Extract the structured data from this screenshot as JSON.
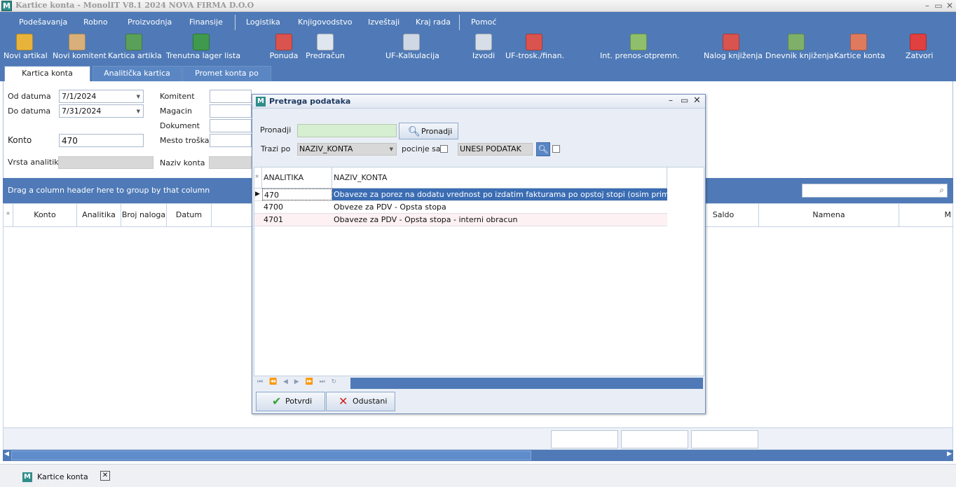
{
  "window": {
    "title": "Kartice konta - MonolIT V8.1 2024 NOVA FIRMA D.O.O",
    "min": "–",
    "max": "▭",
    "close": "✕"
  },
  "menu": [
    "Podešavanja",
    "Robno",
    "Proizvodnja",
    "Finansije",
    "Logistika",
    "Knjigovodstvo",
    "Izveštaji",
    "Kraj rada",
    "Pomoć"
  ],
  "toolbar": [
    {
      "label": "Novi artikal",
      "icon": "basket-icon",
      "color": "#e8b33a"
    },
    {
      "label": "Novi komitent",
      "icon": "person-add-icon",
      "color": "#d9b07a"
    },
    {
      "label": "Kartica artikla",
      "icon": "calendar-icon",
      "color": "#5aa05a"
    },
    {
      "label": "Trenutna lager lista",
      "icon": "chart-doc-icon",
      "color": "#3f9a4d"
    },
    {
      "label": "Ponuda",
      "icon": "offer-icon",
      "color": "#d9534f"
    },
    {
      "label": "Predračun",
      "icon": "document-icon",
      "color": "#dfe6ef"
    },
    {
      "label": "UF-Kalkulacija",
      "icon": "spreadsheet-icon",
      "color": "#cfd8e4"
    },
    {
      "label": "Izvodi",
      "icon": "bank-statement-icon",
      "color": "#d7dee8"
    },
    {
      "label": "UF-trosk./finan.",
      "icon": "cost-icon",
      "color": "#d9534f"
    },
    {
      "label": "Int. prenos-otpremn.",
      "icon": "transfer-icon",
      "color": "#8fbf6a"
    },
    {
      "label": "Nalog knjiženja",
      "icon": "book-icon",
      "color": "#d9534f"
    },
    {
      "label": "Dnevnik knjiženja",
      "icon": "journal-icon",
      "color": "#7fb06a"
    },
    {
      "label": "Kartice konta",
      "icon": "cards-icon",
      "color": "#e07a5f"
    },
    {
      "label": "Zatvori",
      "icon": "close-x-icon",
      "color": "#e04040"
    }
  ],
  "tabs": [
    "Kartica konta",
    "Analitička kartica",
    "Promet konta po analitici"
  ],
  "form": {
    "od_datuma_label": "Od datuma",
    "od_datuma": "7/1/2024",
    "do_datuma_label": "Do datuma",
    "do_datuma": "7/31/2024",
    "konto_label": "Konto",
    "konto": "470",
    "vrsta_analitike_label": "Vrsta analitike",
    "komitent_label": "Komitent",
    "magacin_label": "Magacin",
    "dokument_label": "Dokument",
    "mesto_troska_label": "Mesto troška",
    "naziv_konta_label": "Naziv konta"
  },
  "grid": {
    "group_hint": "Drag a column header here to group by that column",
    "columns": [
      "Konto",
      "Analitika",
      "Broj naloga",
      "Datum",
      "Saldo",
      "Namena",
      "M"
    ]
  },
  "status_tab": "Kartice konta",
  "dialog": {
    "title": "Pretraga podataka",
    "pronadji_label": "Pronadji",
    "pronadji_button": "Pronadji",
    "trazi_po_label": "Trazi po",
    "trazi_po_value": "NAZIV_KONTA",
    "pocinje_sa_label": "pocinje sa",
    "unesi_podatak": "UNESI PODATAK",
    "columns": [
      "ANALITIKA",
      "NAZIV_KONTA"
    ],
    "rows": [
      {
        "analitika": "470",
        "naziv": "Obaveze za porez na dodatu vrednost po izdatim fakturama po opstoj stopi (osim primljenih avansa"
      },
      {
        "analitika": "4700",
        "naziv": "Obveze za PDV - Opsta stopa"
      },
      {
        "analitika": "4701",
        "naziv": "Obaveze za PDV - Opsta stopa - interni obracun"
      }
    ],
    "potvrdi": "Potvrdi",
    "odustani": "Odustani"
  }
}
